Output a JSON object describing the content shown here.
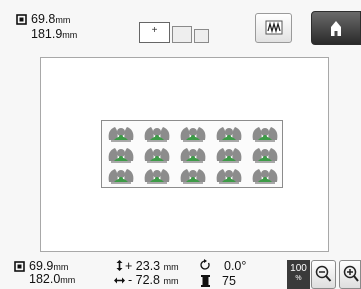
{
  "top_size": {
    "height_value": "69.8",
    "height_unit": "mm",
    "width_value": "181.9",
    "width_unit": "mm"
  },
  "hoop_selector": {
    "active_marker": "+"
  },
  "bottom_size": {
    "height_value": "69.9",
    "height_unit": "mm",
    "width_value": "182.0",
    "width_unit": "mm"
  },
  "position": {
    "vertical_sign": "+",
    "vertical_value": "23.3",
    "vertical_unit": "mm",
    "horizontal_sign": "-",
    "horizontal_value": "72.8",
    "horizontal_unit": "mm"
  },
  "rotation": {
    "value": "0.0°"
  },
  "thread": {
    "value": "75"
  },
  "zoom": {
    "value": "100",
    "unit": "%"
  },
  "icons": {
    "size": "size-box-icon",
    "vertical": "vertical-arrow-icon",
    "horizontal": "horizontal-arrow-icon",
    "rotation": "rotate-icon",
    "thread": "thread-spool-icon",
    "zoom_out": "zoom-out-icon",
    "zoom_in": "zoom-in-icon",
    "home": "home-icon",
    "display": "display-mode-icon"
  },
  "colors": {
    "pattern_gray": "#8c8c8c",
    "pattern_green": "#3d9b47",
    "home_button": "#3a3a3a"
  }
}
